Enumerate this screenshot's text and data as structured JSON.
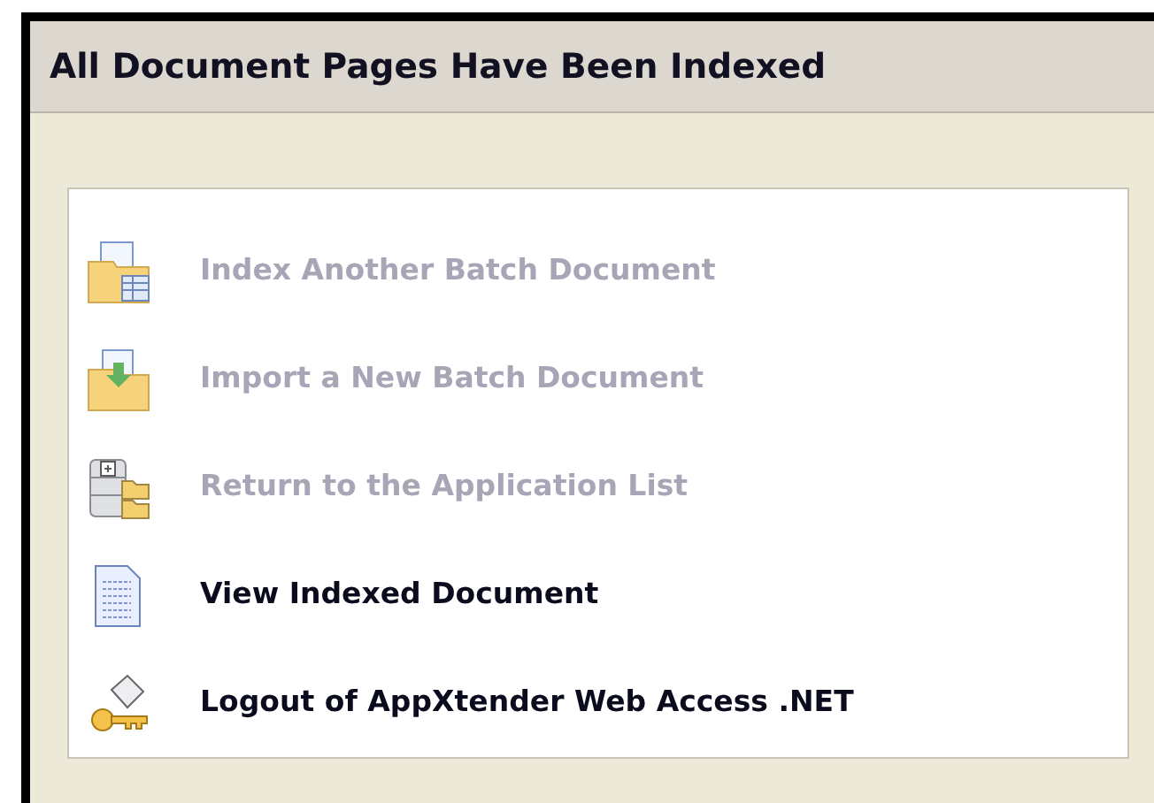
{
  "panel": {
    "title": "All Document Pages Have Been Indexed"
  },
  "actions": [
    {
      "label": "Index Another Batch Document",
      "disabled": true
    },
    {
      "label": "Import a New Batch Document",
      "disabled": true
    },
    {
      "label": "Return to the Application List",
      "disabled": true
    },
    {
      "label": "View Indexed Document",
      "disabled": false
    },
    {
      "label": "Logout of AppXtender Web Access .NET",
      "disabled": false
    }
  ]
}
